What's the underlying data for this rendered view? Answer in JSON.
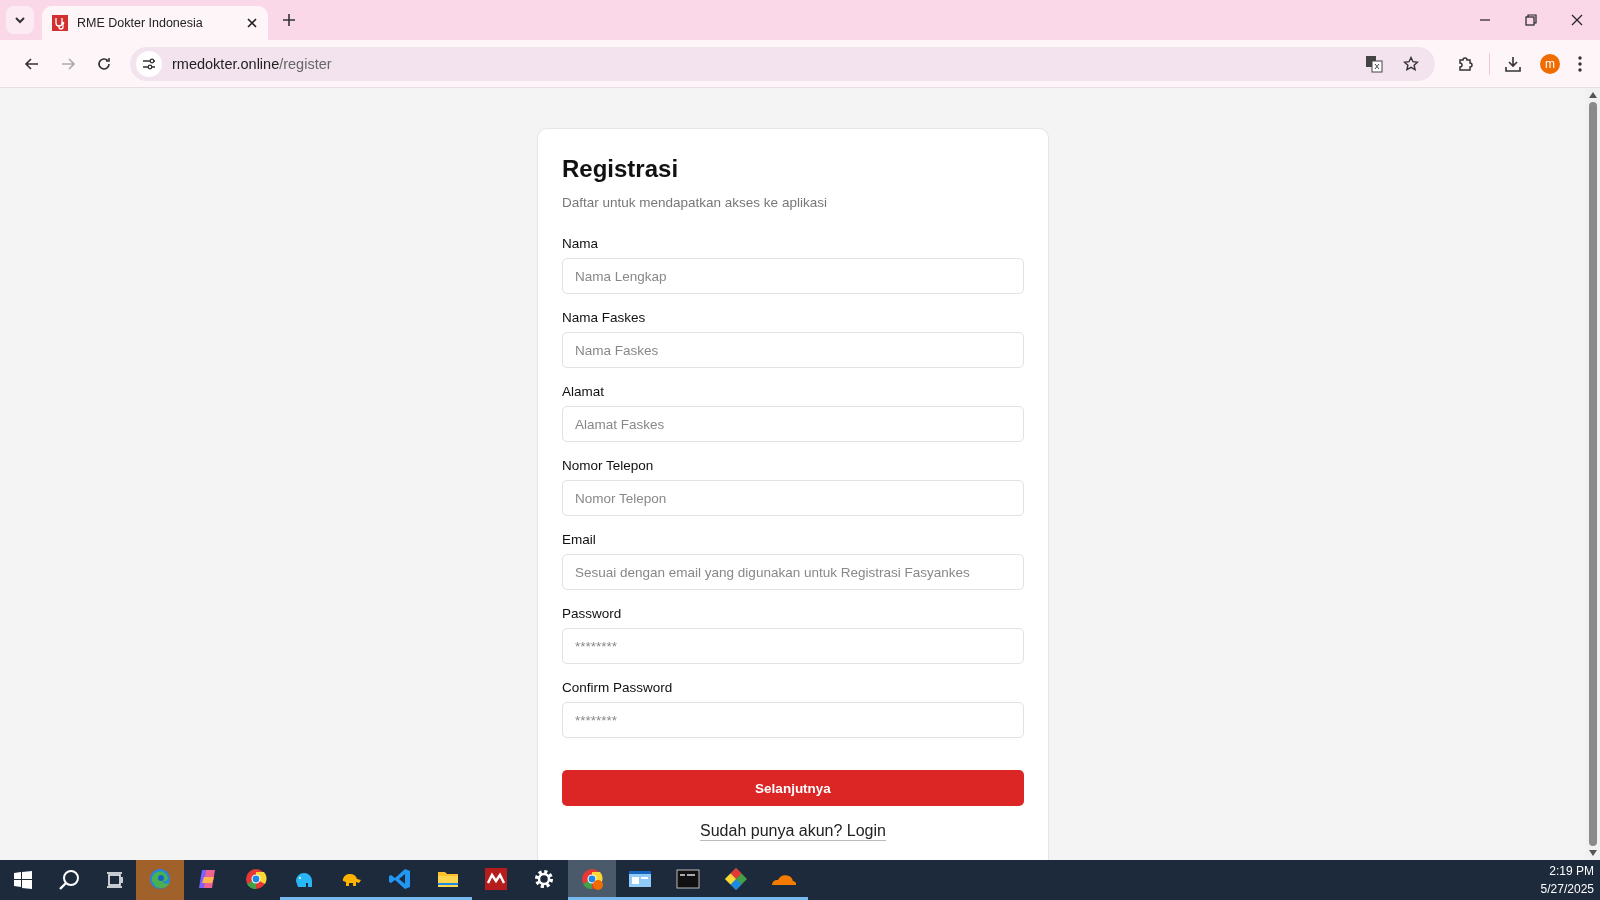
{
  "browser": {
    "tab": {
      "title": "RME Dokter Indonesia",
      "selected": true
    },
    "address": {
      "host": "rmedokter.online",
      "path": "/register"
    },
    "profile_initial": "m"
  },
  "form": {
    "title": "Registrasi",
    "subtitle": "Daftar untuk mendapatkan akses ke aplikasi",
    "fields": [
      {
        "label": "Nama",
        "placeholder": "Nama Lengkap"
      },
      {
        "label": "Nama Faskes",
        "placeholder": "Nama Faskes"
      },
      {
        "label": "Alamat",
        "placeholder": "Alamat Faskes"
      },
      {
        "label": "Nomor Telepon",
        "placeholder": "Nomor Telepon"
      },
      {
        "label": "Email",
        "placeholder": "Sesuai dengan email yang digunakan untuk Registrasi Fasyankes"
      },
      {
        "label": "Password",
        "placeholder": "********"
      },
      {
        "label": "Confirm Password",
        "placeholder": "********"
      }
    ],
    "submit": "Selanjutnya",
    "login_link": "Sudah punya akun? Login"
  },
  "taskbar": {
    "apps": [
      {
        "selected": true,
        "running": false
      },
      {
        "selected": false,
        "running": false
      },
      {
        "selected": false,
        "running": false
      },
      {
        "selected": false,
        "running": true
      },
      {
        "selected": false,
        "running": true
      },
      {
        "selected": false,
        "running": true
      },
      {
        "selected": false,
        "running": true
      },
      {
        "selected": false,
        "running": false
      },
      {
        "selected": false,
        "running": false
      },
      {
        "selected": true,
        "running": true
      },
      {
        "selected": false,
        "running": true
      },
      {
        "selected": false,
        "running": true
      },
      {
        "selected": false,
        "running": true
      },
      {
        "selected": false,
        "running": true
      }
    ],
    "time": "2:19 PM",
    "date": "5/27/2025"
  }
}
